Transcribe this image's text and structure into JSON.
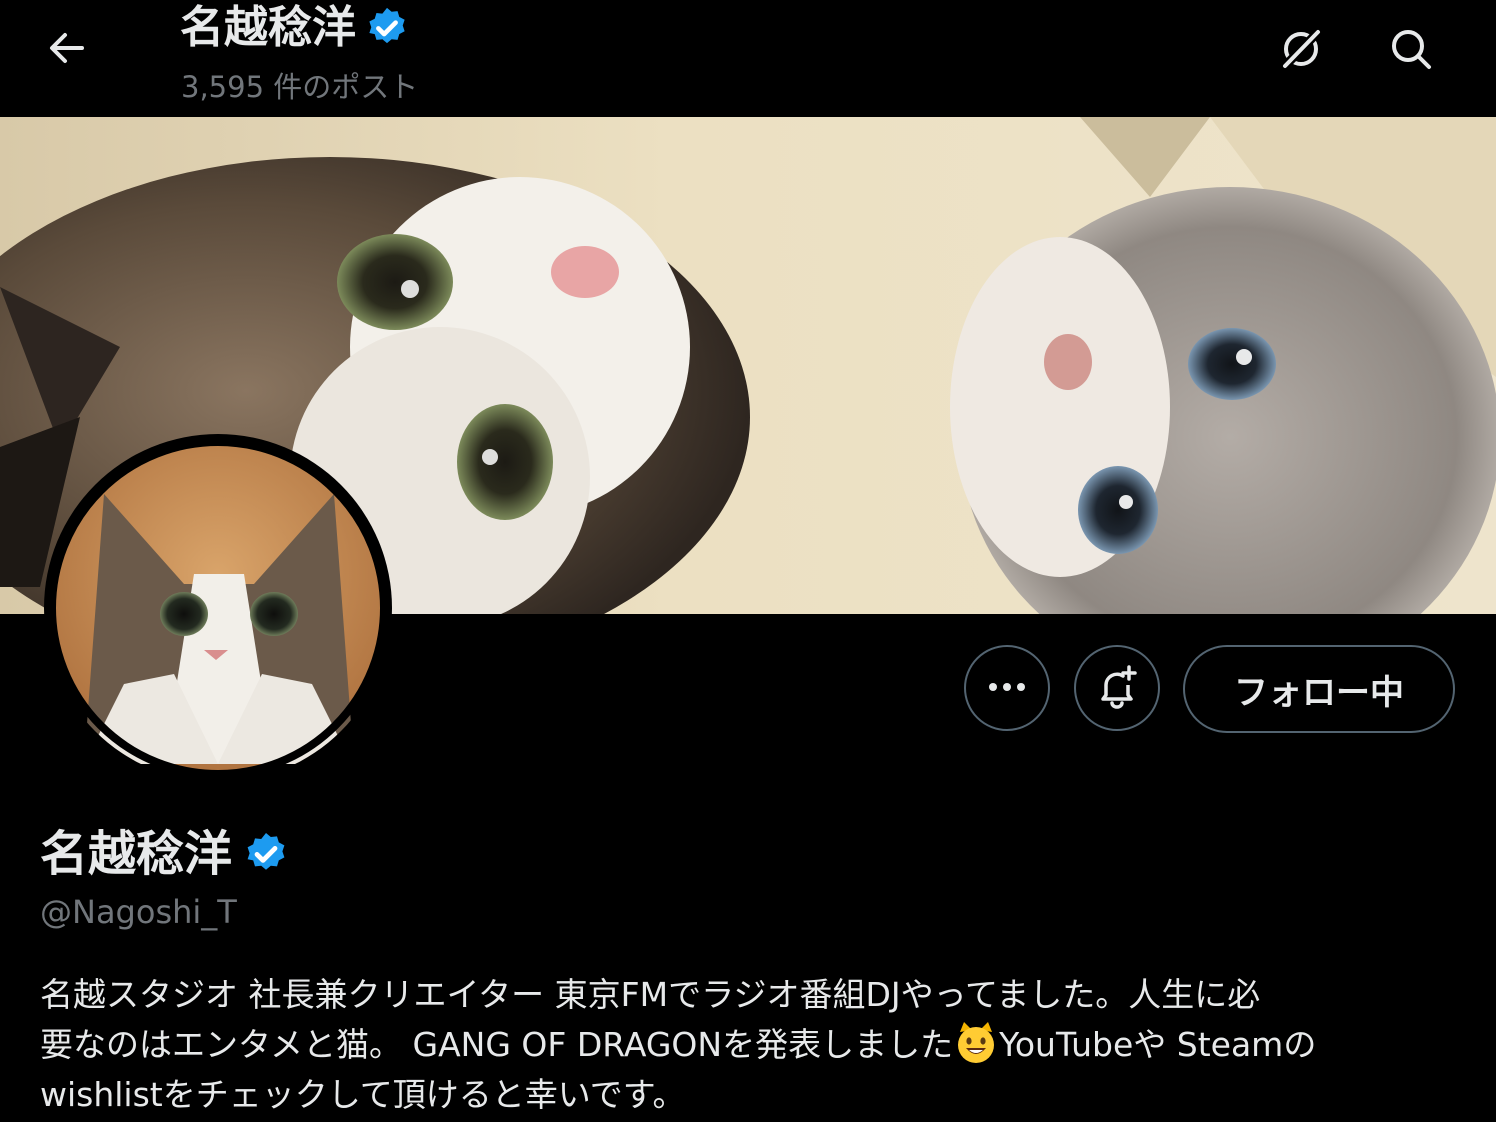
{
  "header": {
    "name": "名越稔洋",
    "post_count": "3,595 件のポスト",
    "icons": [
      "back-arrow-icon",
      "verified-badge-icon",
      "grok-icon",
      "search-icon"
    ]
  },
  "actions": {
    "more_icon": "more-dots-icon",
    "notify_icon": "notification-bell-icon",
    "follow_label": "フォロー中"
  },
  "profile": {
    "name": "名越稔洋",
    "handle": "@Nagoshi_T",
    "bio": {
      "line1": "名越スタジオ 社長兼クリエイター 東京FMでラジオ番組DJやってました。人生に必",
      "line2_before": "要なのはエンタメと猫。 GANG OF  DRAGONを発表しました",
      "line2_after": "YouTubeや Steamの",
      "line3": "wishlistをチェックして頂けると幸いです。",
      "emoji": "grinning-cat-emoji"
    }
  },
  "colors": {
    "background": "#000000",
    "text_primary": "#e7e9ea",
    "text_secondary": "#71767b",
    "verified_blue": "#1d9bf0",
    "button_border": "#536471"
  }
}
